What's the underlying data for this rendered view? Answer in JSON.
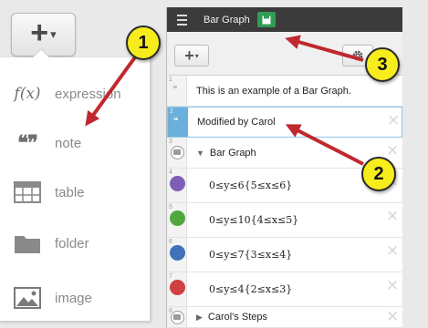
{
  "left_menu": {
    "add_button": {
      "plus": "+",
      "caret": "▾"
    },
    "items": [
      {
        "icon": "function-icon",
        "glyph": "f(x)",
        "label": "expression"
      },
      {
        "icon": "quote-icon",
        "glyph": "❝❞",
        "label": "note"
      },
      {
        "icon": "table-icon",
        "label": "table"
      },
      {
        "icon": "folder-icon",
        "label": "folder"
      },
      {
        "icon": "image-icon",
        "label": "image"
      }
    ]
  },
  "calculator": {
    "title": "Bar Graph",
    "toolbar": {
      "add_plus": "+",
      "add_caret": "▾"
    },
    "rows": [
      {
        "num": "1",
        "type": "note",
        "text": "This is an example of a Bar Graph."
      },
      {
        "num": "2",
        "type": "note",
        "text": "Modified by Carol",
        "selected": true
      },
      {
        "num": "3",
        "type": "folder",
        "text": "Bar Graph"
      },
      {
        "num": "4",
        "type": "expression",
        "text": "0≤y≤6{5≤x≤6}",
        "color": "#7f5fb6"
      },
      {
        "num": "5",
        "type": "expression",
        "text": "0≤y≤10{4≤x≤5}",
        "color": "#4fa83d"
      },
      {
        "num": "6",
        "type": "expression",
        "text": "0≤y≤7{3≤x≤4}",
        "color": "#3f72b8"
      },
      {
        "num": "7",
        "type": "expression",
        "text": "0≤y≤4{2≤x≤3}",
        "color": "#cf4040"
      },
      {
        "num": "8",
        "type": "folder-collapsed",
        "text": "Carol's Steps"
      }
    ],
    "delete_glyph": "×"
  },
  "callouts": [
    {
      "label": "1"
    },
    {
      "label": "2"
    },
    {
      "label": "3"
    }
  ],
  "colors": {
    "callout_fill": "#f7ec1c",
    "arrow": "#c0282f",
    "save_green": "#2f9e54",
    "selected_blue": "#6bb0dd"
  }
}
